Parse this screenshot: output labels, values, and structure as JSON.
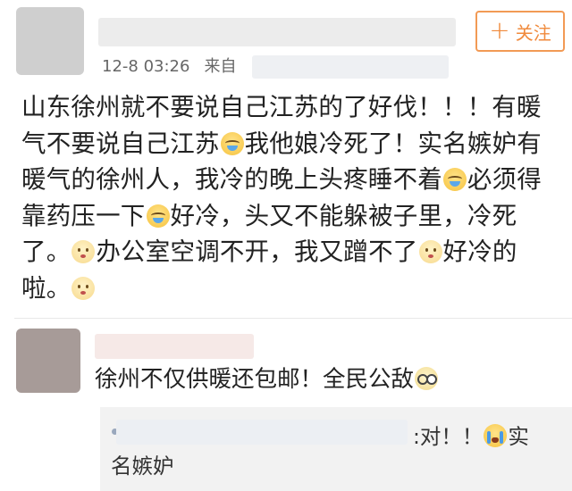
{
  "post": {
    "follow_label": "关注",
    "timestamp": "12-8 03:26",
    "source_prefix": "来自",
    "lines": [
      [
        "山东徐州就不要说自己江苏的了好伐！！！有暖"
      ],
      [
        "气不要说自己江苏",
        "我他娘冷死了！实名嫉妒有"
      ],
      [
        "暖气的徐州人，我冷的晚上头疼睡不着",
        "必须得"
      ],
      [
        "靠药压一下",
        "好冷，头又不能躲被子里，冷死"
      ],
      [
        "了。",
        "办公室空调不开，我又蹭不了",
        "好冷的"
      ],
      [
        "啦。"
      ]
    ],
    "emoji_icons": {
      "line2": "cry-laugh-emoji",
      "line3": "cry-laugh-emoji",
      "line4": "cry-laugh-emoji",
      "line5a": "sad-face-emoji",
      "line5b": "sad-face-emoji",
      "line6": "sad-face-emoji"
    }
  },
  "reply": {
    "text": "徐州不仅供暖还包邮！全民公敌",
    "emoji": "glasses-face-emoji"
  },
  "quote": {
    "text_tail": ":对！！",
    "text_end": "实",
    "line2": "名嫉妒",
    "emoji": "crying-face-emoji"
  },
  "colors": {
    "follow_accent": "#f08a3c",
    "text": "#222222",
    "meta": "#666666",
    "quote_bg": "#f2f2f2"
  }
}
